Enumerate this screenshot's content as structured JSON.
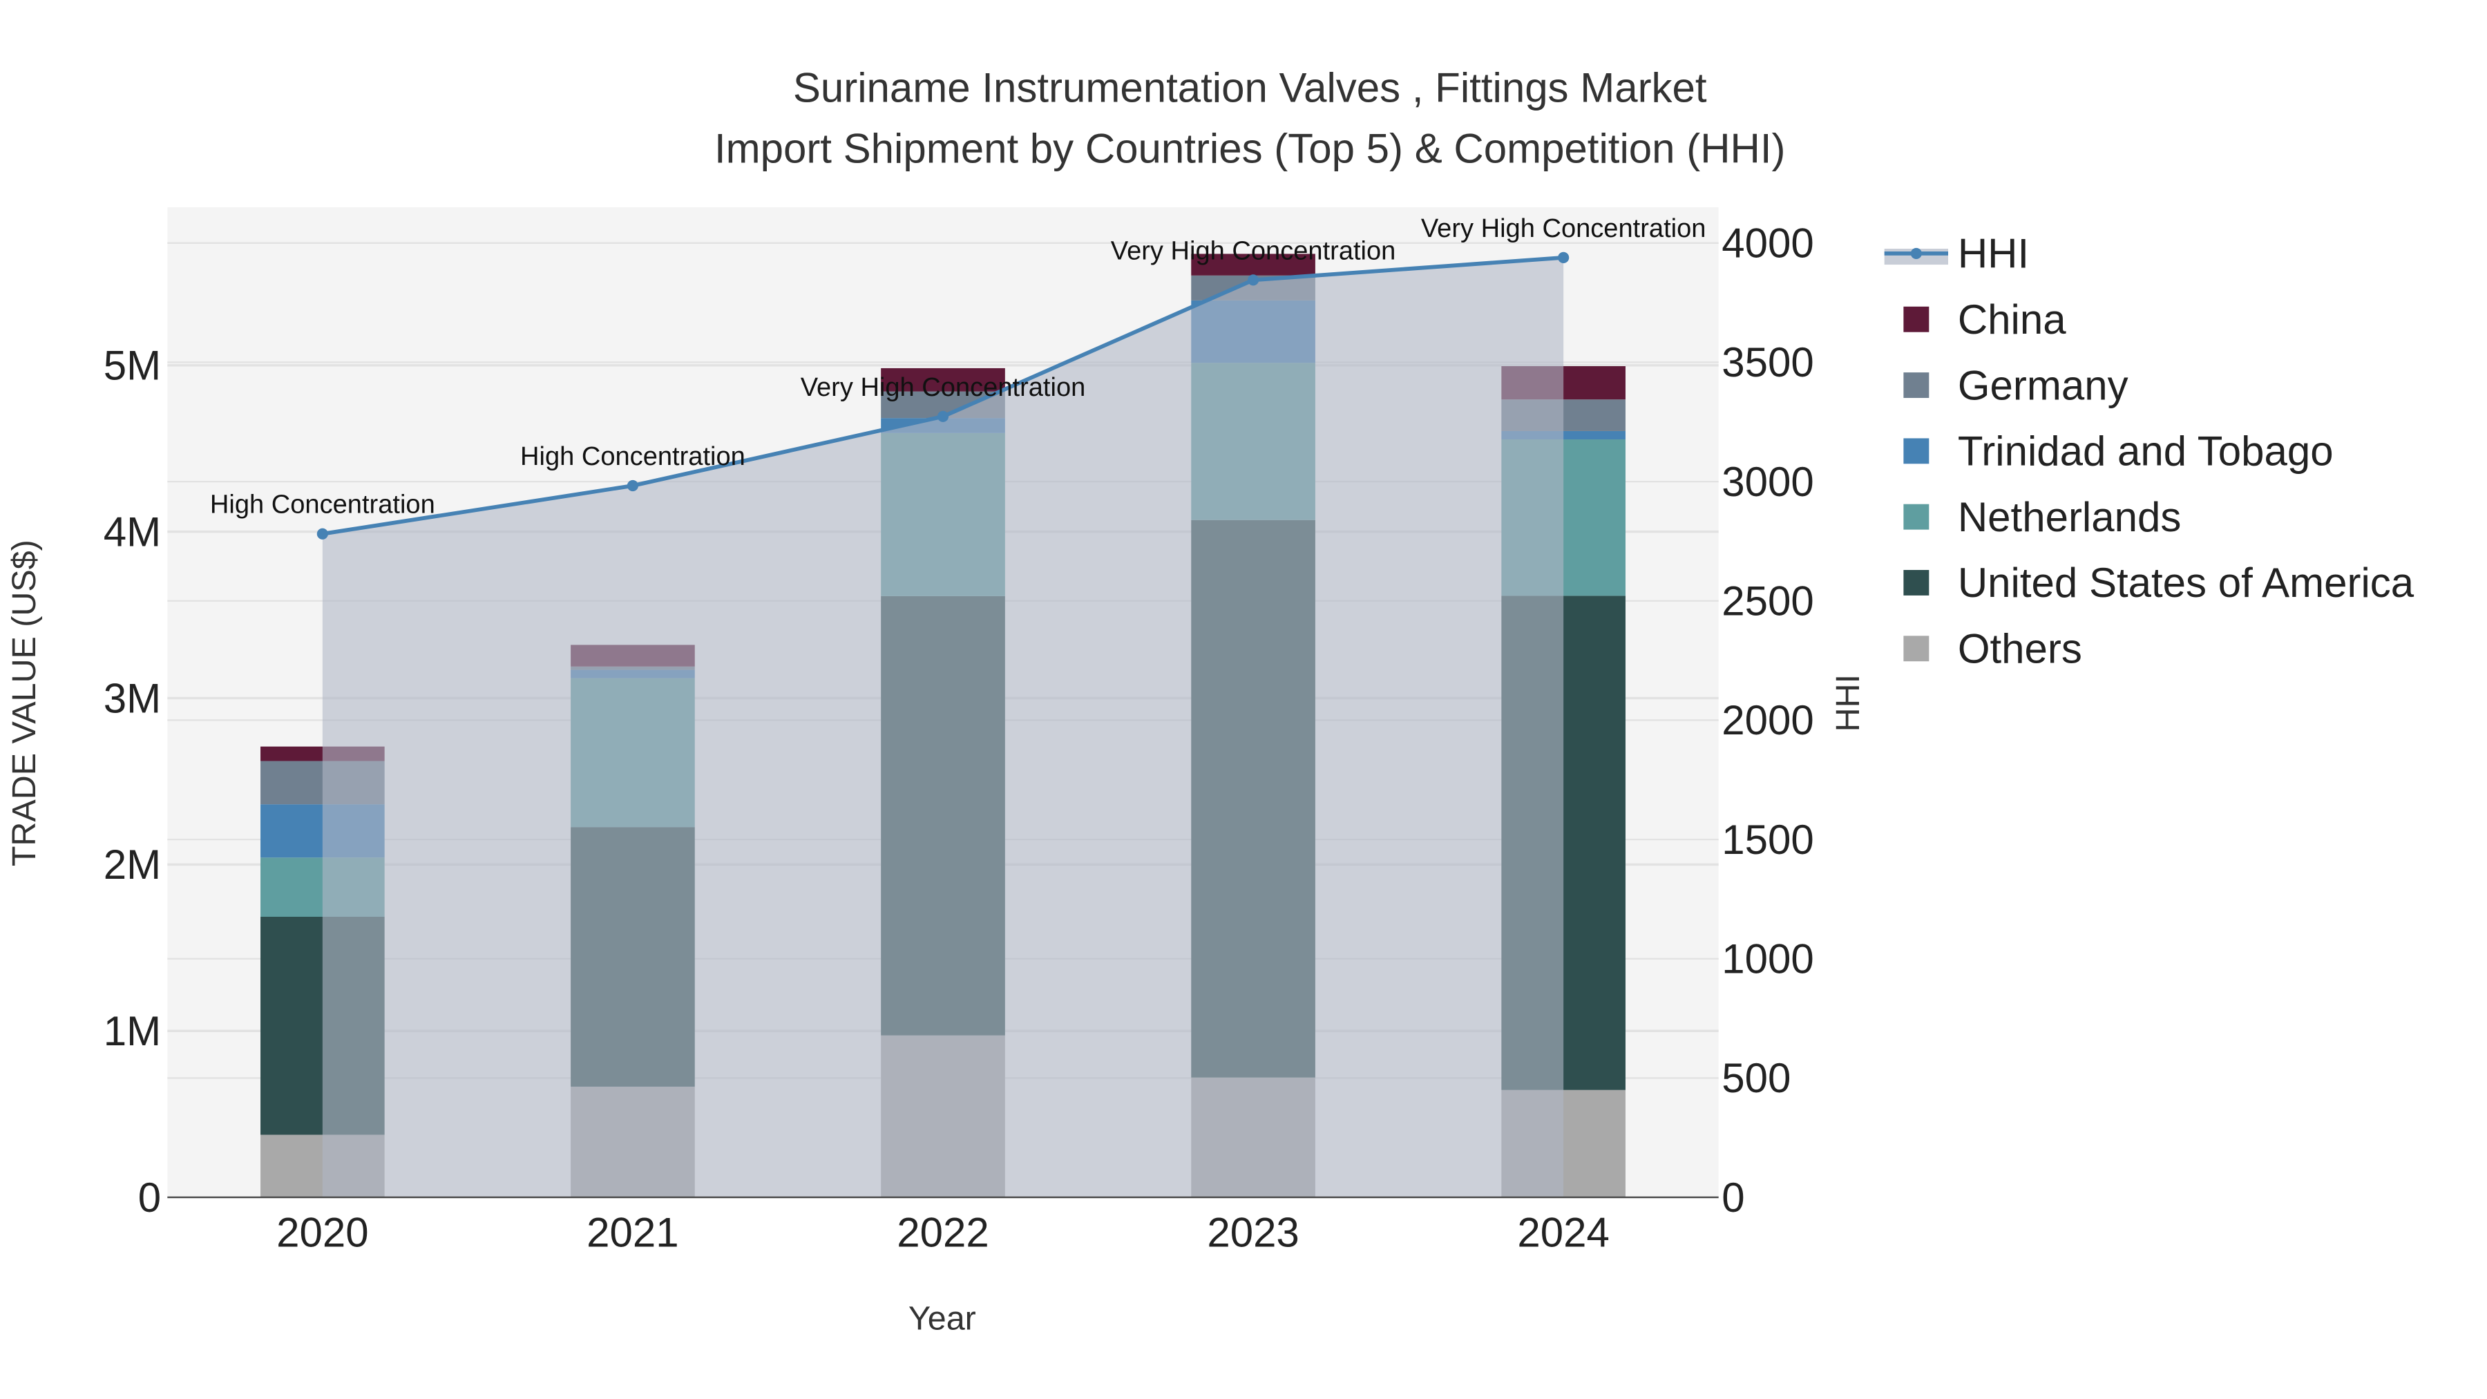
{
  "chart_data": {
    "type": "bar",
    "title_line1": "Suriname Instrumentation Valves , Fittings Market",
    "title_line2": "Import Shipment by Countries (Top 5) & Competition (HHI)",
    "xlabel": "Year",
    "ylabel": "TRADE VALUE (US$)",
    "y2label": "HHI",
    "categories": [
      "2020",
      "2021",
      "2022",
      "2023",
      "2024"
    ],
    "ylim": [
      0,
      5950000
    ],
    "y2lim": [
      0,
      4150
    ],
    "yticks": [
      0,
      1000000,
      2000000,
      3000000,
      4000000,
      5000000
    ],
    "ytick_labels": [
      "0",
      "1M",
      "2M",
      "3M",
      "4M",
      "5M"
    ],
    "y2ticks": [
      0,
      500,
      1000,
      1500,
      2000,
      2500,
      3000,
      3500,
      4000
    ],
    "y2tick_labels": [
      "0",
      "500",
      "1000",
      "1500",
      "2000",
      "2500",
      "3000",
      "3500",
      "4000"
    ],
    "grid": true,
    "legend_position": "right",
    "series": [
      {
        "name": "Others",
        "color": "#a9a9a9",
        "values": [
          376000,
          665000,
          973000,
          720000,
          645000
        ]
      },
      {
        "name": "United States of America",
        "color": "#2f4f4f",
        "values": [
          1310000,
          1560000,
          2640000,
          3350000,
          2970000
        ]
      },
      {
        "name": "Netherlands",
        "color": "#5f9ea0",
        "values": [
          356000,
          895000,
          980000,
          945000,
          940000
        ]
      },
      {
        "name": "Trinidad and Tobago",
        "color": "#4682b4",
        "values": [
          320000,
          50000,
          90000,
          375000,
          50000
        ]
      },
      {
        "name": "Germany",
        "color": "#708090",
        "values": [
          260000,
          20000,
          160000,
          150000,
          190000
        ]
      },
      {
        "name": "China",
        "color": "#5e1a38",
        "values": [
          87000,
          130000,
          140000,
          130000,
          200000
        ]
      }
    ],
    "hhi": {
      "name": "HHI",
      "color": "#4682b4",
      "values": [
        2781,
        2983,
        3273,
        3845,
        3939
      ],
      "annotations": [
        "High Concentration",
        "High Concentration",
        "Very High Concentration",
        "Very High Concentration",
        "Very High Concentration"
      ]
    },
    "legend_order": [
      "HHI",
      "China",
      "Germany",
      "Trinidad and Tobago",
      "Netherlands",
      "United States of America",
      "Others"
    ]
  }
}
